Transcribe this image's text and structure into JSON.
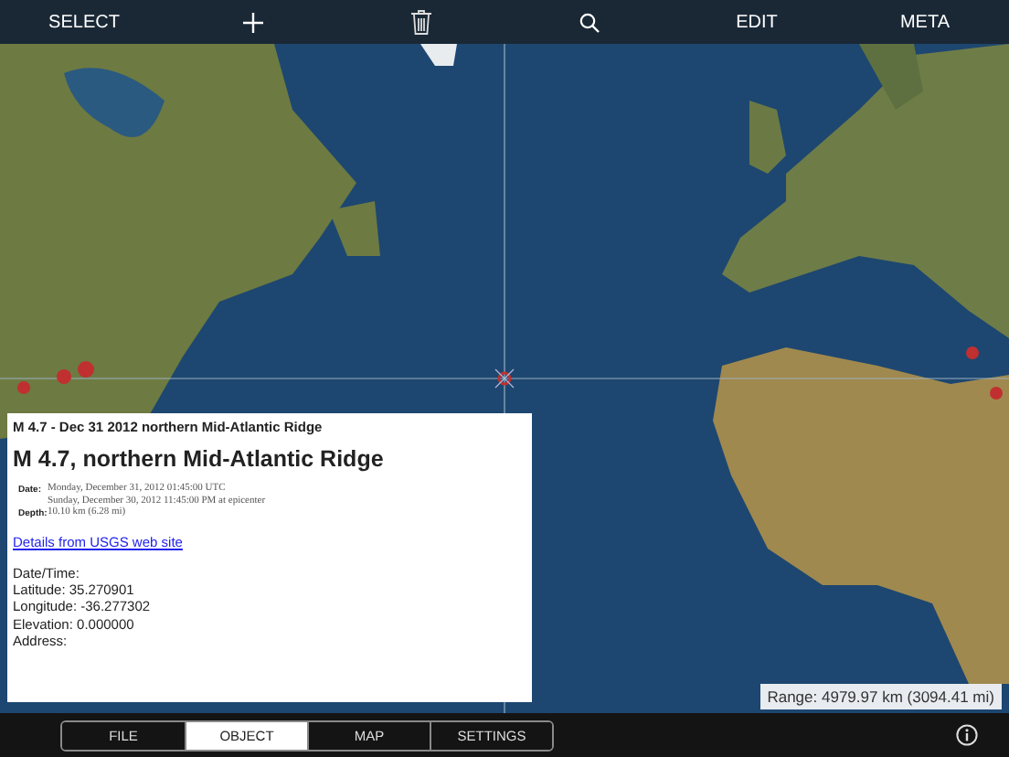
{
  "toolbar": {
    "select": "SELECT",
    "edit": "EDIT",
    "meta": "META"
  },
  "info_panel": {
    "header": "M 4.7 - Dec 31 2012 northern Mid-Atlantic Ridge",
    "title": "M 4.7, northern Mid-Atlantic Ridge",
    "details": [
      {
        "label": "Date:",
        "lines": [
          "Monday, December 31, 2012 01:45:00 UTC",
          "Sunday, December 30, 2012 11:45:00 PM at epicenter"
        ]
      },
      {
        "label": "Depth:",
        "lines": [
          "10.10 km (6.28 mi)"
        ]
      }
    ],
    "link": "Details from USGS web site",
    "fields": [
      "Date/Time:",
      "Latitude: 35.270901",
      "Longitude: -36.277302",
      "Elevation: 0.000000",
      "Address:"
    ]
  },
  "range": "Range: 4979.97 km (3094.41 mi)",
  "tabs": [
    {
      "label": "FILE",
      "selected": false
    },
    {
      "label": "OBJECT",
      "selected": true
    },
    {
      "label": "MAP",
      "selected": false
    },
    {
      "label": "SETTINGS",
      "selected": false
    }
  ]
}
